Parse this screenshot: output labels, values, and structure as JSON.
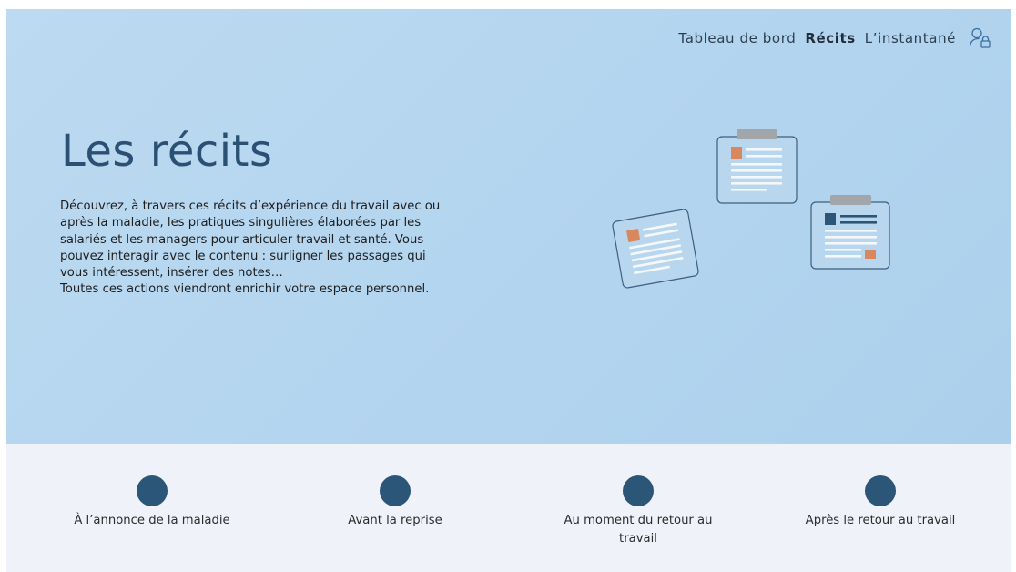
{
  "nav": {
    "items": [
      {
        "label": "Tableau de bord",
        "active": false
      },
      {
        "label": "Récits",
        "active": true
      },
      {
        "label": "L’instantané",
        "active": false
      }
    ],
    "account_icon": "user-lock-icon"
  },
  "hero": {
    "title": "Les récits",
    "description_lines": [
      "Découvrez, à travers ces récits d’expérience du travail avec ou",
      "après la maladie, les pratiques singulières élaborées par les",
      "salariés et les managers pour articuler travail et santé. Vous",
      "pouvez interagir avec le contenu : surligner les passages qui",
      "vous intéressent, insérer des notes…",
      "Toutes ces actions viendront enrichir votre espace personnel."
    ],
    "illustration": "clipboards-illustration"
  },
  "steps": [
    {
      "label": "À l’annonce de la maladie"
    },
    {
      "label": "Avant la reprise"
    },
    {
      "label": "Au moment du retour au travail"
    },
    {
      "label": "Après le retour au travail"
    }
  ],
  "colors": {
    "hero_background": "#b4d5ef",
    "title": "#2a5074",
    "dot": "#2b5677",
    "steps_background": "#eff2f8",
    "accent_orange": "#d9875d"
  }
}
